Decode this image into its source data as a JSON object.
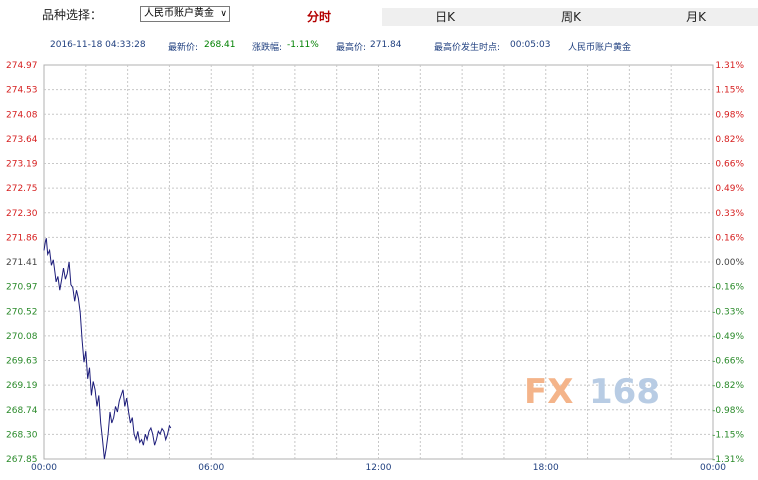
{
  "toolbar": {
    "selector_label": "品种选择：",
    "selected_product": "人民币账户黄金",
    "tabs": [
      {
        "label": "分时",
        "active": true
      },
      {
        "label": "日K",
        "active": false
      },
      {
        "label": "周K",
        "active": false
      },
      {
        "label": "月K",
        "active": false
      }
    ]
  },
  "info": {
    "datetime": "2016-11-18 04:33:28",
    "latest_label": "最新价:",
    "latest_value": "268.41",
    "change_label": "涨跌幅:",
    "change_value": "-1.11%",
    "high_label": "最高价:",
    "high_value": "271.84",
    "high_time_label": "最高价发生时点:",
    "high_time_value": "00:05:03",
    "product": "人民币账户黄金"
  },
  "watermark": "FX168",
  "colors": {
    "line": "#1c1c7a",
    "up": "#d62020",
    "down": "#2a8a2a",
    "base": "#444444",
    "grid": "#c8c8c8",
    "xlabel": "#1f3f7f",
    "watermark_fx": "#f4b48a",
    "watermark_num": "#b8cce4"
  },
  "chart_data": {
    "type": "line",
    "x_ticks": [
      "00:00",
      "06:00",
      "12:00",
      "18:00",
      "00:00"
    ],
    "y_ticks_left": [
      "274.97",
      "274.53",
      "274.08",
      "273.64",
      "273.19",
      "272.75",
      "272.30",
      "271.86",
      "271.41",
      "270.97",
      "270.52",
      "270.08",
      "269.63",
      "269.19",
      "268.74",
      "268.30",
      "267.85"
    ],
    "y_ticks_right": [
      "1.31%",
      "1.15%",
      "0.98%",
      "0.82%",
      "0.66%",
      "0.49%",
      "0.33%",
      "0.16%",
      "0.00%",
      "-0.16%",
      "-0.33%",
      "-0.49%",
      "-0.66%",
      "-0.82%",
      "-0.98%",
      "-1.15%",
      "-1.31%"
    ],
    "baseline": 271.41,
    "ylim": [
      267.85,
      274.97
    ],
    "xlim_minutes": [
      0,
      1440
    ],
    "series": [
      {
        "x_minutes": [
          0,
          3,
          5,
          8,
          12,
          16,
          20,
          24,
          26,
          30,
          34,
          38,
          42,
          46,
          50,
          54,
          58,
          62,
          66,
          70,
          74,
          78,
          82,
          86,
          90,
          94,
          98,
          102,
          106,
          110,
          114,
          118,
          122,
          126,
          130,
          134,
          138,
          142,
          146,
          150,
          154,
          158,
          162,
          166,
          170,
          174,
          178,
          182,
          186,
          190,
          194,
          198,
          202,
          206,
          210,
          214,
          218,
          222,
          226,
          230,
          234,
          238,
          242,
          246,
          250,
          254,
          258,
          262,
          266,
          270,
          273
        ],
        "values": [
          271.62,
          271.78,
          271.84,
          271.55,
          271.62,
          271.35,
          271.45,
          271.2,
          271.05,
          271.15,
          270.9,
          271.1,
          271.3,
          271.1,
          271.2,
          271.41,
          271.0,
          270.95,
          270.7,
          270.9,
          270.75,
          270.5,
          270.0,
          269.6,
          269.8,
          269.3,
          269.5,
          269.0,
          269.25,
          269.1,
          268.8,
          269.0,
          268.5,
          268.2,
          267.85,
          268.05,
          268.3,
          268.7,
          268.5,
          268.6,
          268.8,
          268.7,
          268.9,
          269.0,
          269.1,
          268.8,
          268.95,
          268.7,
          268.5,
          268.6,
          268.3,
          268.2,
          268.35,
          268.15,
          268.2,
          268.1,
          268.3,
          268.2,
          268.35,
          268.41,
          268.3,
          268.1,
          268.2,
          268.35,
          268.3,
          268.4,
          268.35,
          268.2,
          268.3,
          268.45,
          268.41
        ]
      }
    ]
  }
}
